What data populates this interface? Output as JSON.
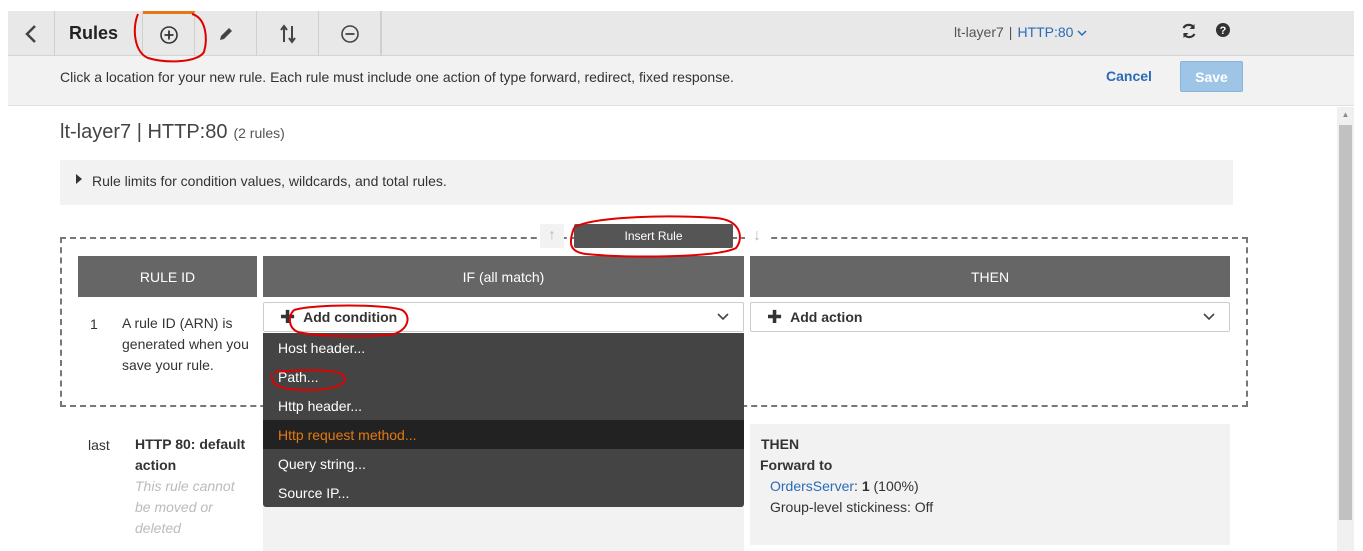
{
  "toolbar": {
    "title": "Rules",
    "listener_name": "lt-layer7",
    "listener_sep": "|",
    "listener_port": "HTTP:80"
  },
  "infobar": {
    "message": "Click a location for your new rule. Each rule must include one action of type forward, redirect, fixed response.",
    "cancel_label": "Cancel",
    "save_label": "Save"
  },
  "page": {
    "heading": "lt-layer7 | HTTP:80",
    "rule_count": "(2 rules)",
    "limits_text": "Rule limits for condition values, wildcards, and total rules."
  },
  "rules_table": {
    "insert_label": "Insert Rule",
    "columns": [
      "RULE ID",
      "IF (all match)",
      "THEN"
    ],
    "new_rule": {
      "number": "1",
      "description": "A rule ID (ARN) is generated when you save your rule.",
      "add_condition_label": "Add condition",
      "add_action_label": "Add action"
    },
    "condition_menu": [
      {
        "label": "Host header...",
        "highlighted": false
      },
      {
        "label": "Path...",
        "highlighted": false
      },
      {
        "label": "Http header...",
        "highlighted": false
      },
      {
        "label": "Http request method...",
        "highlighted": true
      },
      {
        "label": "Query string...",
        "highlighted": false
      },
      {
        "label": "Source IP...",
        "highlighted": false
      }
    ],
    "default_rule": {
      "number": "last",
      "title": "HTTP 80: default action",
      "note": "This rule cannot be moved or deleted",
      "then_label": "THEN",
      "forward_label": "Forward to",
      "target_group": "OrdersServer",
      "weight_bold": "1",
      "weight_pct": "(100%)",
      "stickiness": "Group-level stickiness: Off"
    }
  },
  "colors": {
    "accent_orange": "#e47911",
    "link_blue": "#2a6bb5",
    "header_gray": "#666666",
    "menu_bg": "#444444",
    "annotation_red": "#e00000"
  }
}
